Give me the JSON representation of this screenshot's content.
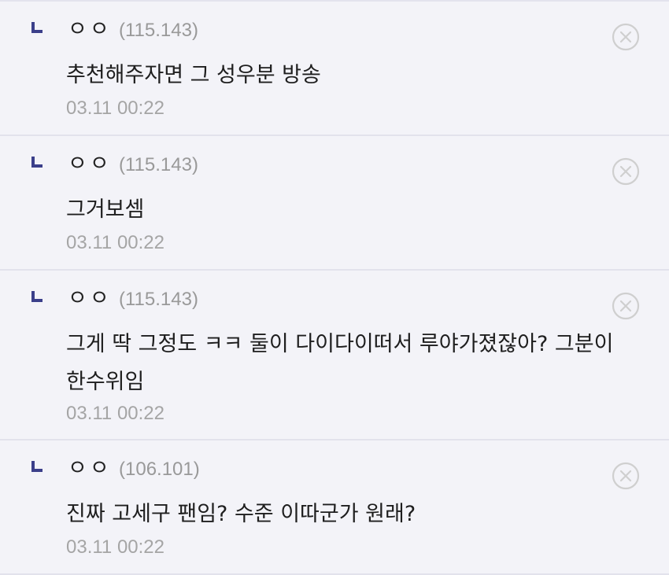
{
  "comments": [
    {
      "nick": "ㅇㅇ",
      "ip": "(115.143)",
      "text": "추천해주자면 그 성우분 방송",
      "time": "03.11 00:22",
      "delete_icon": "close-circle-icon"
    },
    {
      "nick": "ㅇㅇ",
      "ip": "(115.143)",
      "text": "그거보셈",
      "time": "03.11 00:22",
      "delete_icon": "close-circle-icon"
    },
    {
      "nick": "ㅇㅇ",
      "ip": "(115.143)",
      "text": "그게 딱 그정도 ㅋㅋ 둘이 다이다이떠서 루야가졌잖아? 그분이 한수위임",
      "time": "03.11 00:22",
      "delete_icon": "close-circle-icon"
    },
    {
      "nick": "ㅇㅇ",
      "ip": "(106.101)",
      "text": "진짜 고세구 팬임? 수준 이따군가 원래?",
      "time": "03.11 00:22",
      "delete_icon": "close-circle-icon"
    }
  ],
  "colors": {
    "background": "#f3f3f8",
    "reply_mark": "#3b3f8a",
    "divider": "#e2e2ec",
    "meta_text": "#a5a5a5"
  }
}
